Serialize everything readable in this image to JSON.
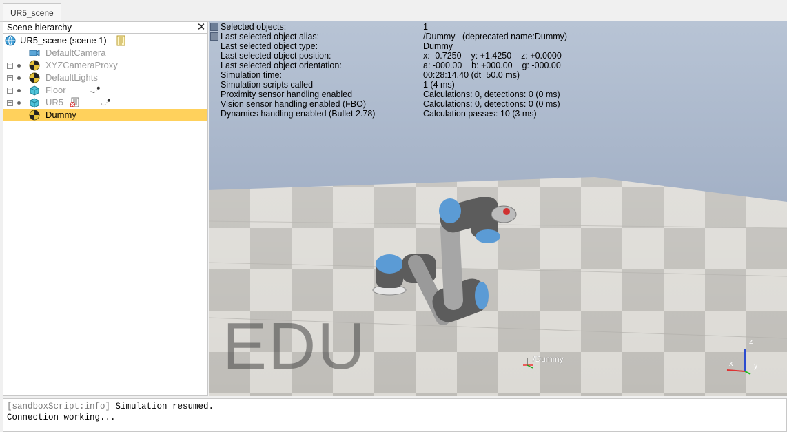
{
  "tab": {
    "label": "UR5_scene"
  },
  "hierarchy": {
    "title": "Scene hierarchy",
    "close_glyph": "✕",
    "items": [
      {
        "label": "UR5_scene (scene 1)",
        "icon": "globe-icon",
        "state": "normal"
      },
      {
        "label": "DefaultCamera",
        "icon": "camera-icon",
        "state": "greyed"
      },
      {
        "label": "XYZCameraProxy",
        "icon": "dummy-icon",
        "state": "greyed"
      },
      {
        "label": "DefaultLights",
        "icon": "dummy-icon",
        "state": "greyed"
      },
      {
        "label": "Floor",
        "icon": "shape-icon",
        "state": "greyed"
      },
      {
        "label": "UR5",
        "icon": "shape-icon",
        "state": "greyed"
      },
      {
        "label": "Dummy",
        "icon": "dummy-icon",
        "state": "selected"
      }
    ]
  },
  "info": {
    "rows": [
      {
        "label": "Selected objects:",
        "value": "1"
      },
      {
        "label": "Last selected object alias:",
        "value": "/Dummy   (deprecated name:Dummy)"
      },
      {
        "label": "Last selected object type:",
        "value": "Dummy"
      },
      {
        "label": "Last selected object position:",
        "value": "x: -0.7250    y: +1.4250    z: +0.0000"
      },
      {
        "label": "Last selected object orientation:",
        "value": "a: -000.00    b: +000.00    g: -000.00"
      },
      {
        "label": "Simulation time:",
        "value": "00:28:14.40 (dt=50.0 ms)"
      },
      {
        "label": "Simulation scripts called",
        "value": "1 (4 ms)"
      },
      {
        "label": "Proximity sensor handling enabled",
        "value": "Calculations: 0, detections: 0 (0 ms)"
      },
      {
        "label": "Vision sensor handling enabled (FBO)",
        "value": "Calculations: 0, detections: 0 (0 ms)"
      },
      {
        "label": "Dynamics handling enabled (Bullet 2.78)",
        "value": "Calculation passes: 10 (3 ms)"
      }
    ]
  },
  "viewport": {
    "watermark": "EDU",
    "object_label": "/Dummy",
    "axes": {
      "x": "x",
      "y": "y",
      "z": "z"
    }
  },
  "console": {
    "lines": [
      {
        "tag": "[sandboxScript:info]",
        "text": " Simulation resumed."
      },
      {
        "tag": "",
        "text": "Connection working..."
      }
    ]
  },
  "colors": {
    "selection": "#ffd15c",
    "robot_joint": "#5b9bd5",
    "robot_link": "#9a9a9a"
  }
}
